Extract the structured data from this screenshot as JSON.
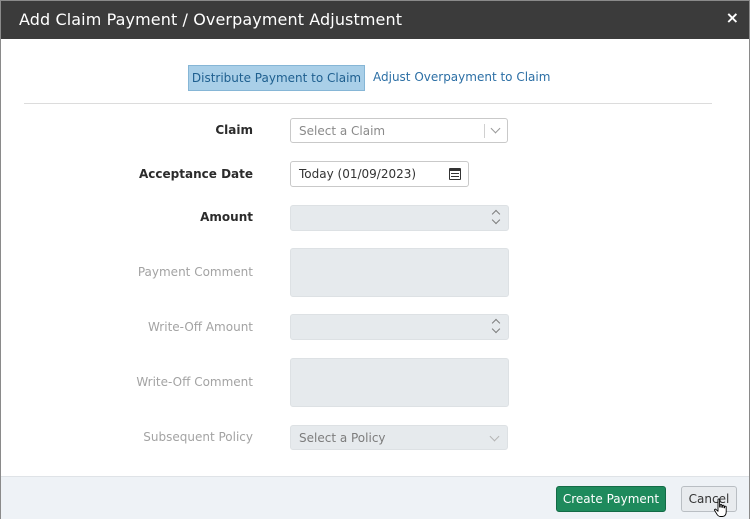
{
  "dialog": {
    "title": "Add Claim Payment / Overpayment Adjustment",
    "close_label": "×"
  },
  "tabs": [
    {
      "label": "Distribute Payment to Claim",
      "active": true
    },
    {
      "label": "Adjust Overpayment to Claim",
      "active": false
    }
  ],
  "form": {
    "claim": {
      "label": "Claim",
      "placeholder": "Select a Claim"
    },
    "acceptance_date": {
      "label": "Acceptance Date",
      "value": "Today (01/09/2023)"
    },
    "amount": {
      "label": "Amount",
      "value": ""
    },
    "payment_comment": {
      "label": "Payment Comment",
      "value": ""
    },
    "write_off_amount": {
      "label": "Write-Off Amount",
      "value": ""
    },
    "write_off_comment": {
      "label": "Write-Off Comment",
      "value": ""
    },
    "subsequent_policy": {
      "label": "Subsequent Policy",
      "placeholder": "Select a Policy"
    }
  },
  "footer": {
    "create_label": "Create Payment",
    "cancel_label": "Cancel"
  },
  "colors": {
    "header_bg": "#3b3b3b",
    "active_tab_bg": "#a9cfe8",
    "link": "#2c6fa5",
    "primary_button": "#1e8a5c",
    "disabled_field": "#e6eaed"
  }
}
